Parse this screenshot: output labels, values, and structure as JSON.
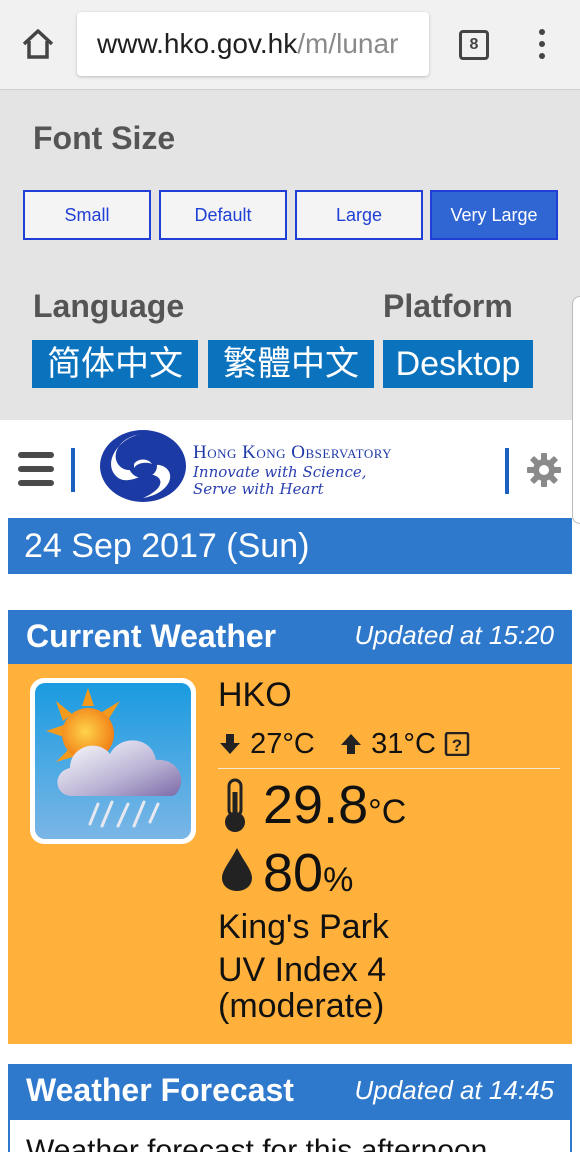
{
  "browser": {
    "url_main": "www.hko.gov.hk",
    "url_path": "/m/lunar",
    "tab_count": "8",
    "icons": {
      "home": "home-icon",
      "tabs": "tabs-icon",
      "menu": "more-vert-icon"
    }
  },
  "settings": {
    "font_size_title": "Font Size",
    "font_sizes": [
      "Small",
      "Default",
      "Large",
      "Very Large"
    ],
    "selected_font_size": "Very Large",
    "language_title": "Language",
    "languages": [
      "简体中文",
      "繁體中文"
    ],
    "platform_title": "Platform",
    "platform_button": "Desktop"
  },
  "header": {
    "org_name": "Hong Kong Observatory",
    "slogan_line1": "Innovate with Science,",
    "slogan_line2": "Serve with Heart"
  },
  "date": "24 Sep 2017 (Sun)",
  "current_weather": {
    "title": "Current Weather",
    "updated": "Updated at 15:20",
    "station": "HKO",
    "min_temp": "27°C",
    "max_temp": "31°C",
    "temperature": "29.8",
    "temp_unit": "°C",
    "humidity": "80",
    "humidity_unit": "%",
    "location": "King's Park",
    "uv_line1": "UV Index 4",
    "uv_line2": "(moderate)"
  },
  "forecast": {
    "title": "Weather Forecast",
    "updated": "Updated at 14:45",
    "text": "Weather forecast for this afternoon"
  },
  "colors": {
    "accent_blue": "#2f79cc",
    "button_blue": "#0b72be",
    "weather_orange": "#ffb13b",
    "panel_gray": "#e4e4e4"
  }
}
